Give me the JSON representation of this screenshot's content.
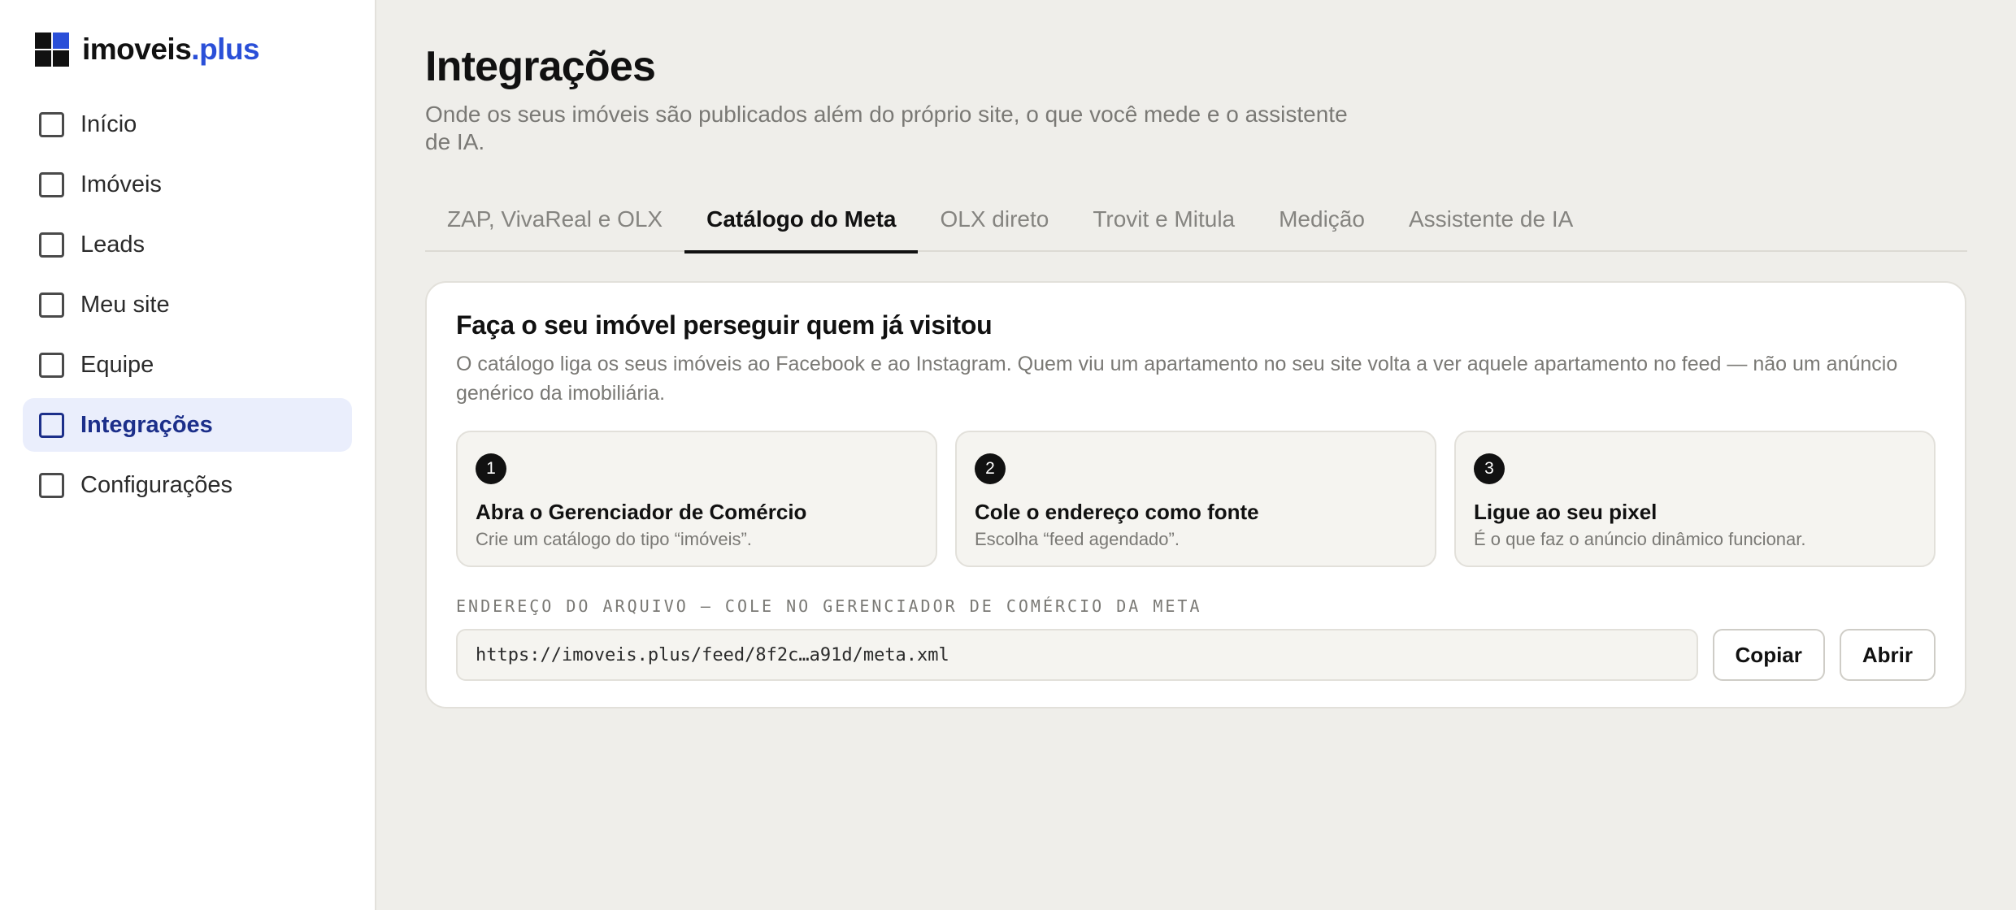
{
  "brand": {
    "name_main": "imoveis",
    "name_accent": ".plus",
    "colors": {
      "blue": "#2a4fd8",
      "dark": "#111111"
    }
  },
  "sidebar": {
    "items": [
      {
        "label": "Início",
        "icon": "checkbox-icon",
        "active": false
      },
      {
        "label": "Imóveis",
        "icon": "checkbox-icon",
        "active": false
      },
      {
        "label": "Leads",
        "icon": "checkbox-icon",
        "active": false
      },
      {
        "label": "Meu site",
        "icon": "checkbox-icon",
        "active": false
      },
      {
        "label": "Equipe",
        "icon": "checkbox-icon",
        "active": false
      },
      {
        "label": "Integrações",
        "icon": "checkbox-icon",
        "active": true
      },
      {
        "label": "Configurações",
        "icon": "checkbox-icon",
        "active": false
      }
    ]
  },
  "header": {
    "title": "Integrações",
    "subtitle": "Onde os seus imóveis são publicados além do próprio site, o que você mede e o assistente de IA."
  },
  "tabs": [
    {
      "label": "ZAP, VivaReal e OLX",
      "active": false
    },
    {
      "label": "Catálogo do Meta",
      "active": true
    },
    {
      "label": "OLX direto",
      "active": false
    },
    {
      "label": "Trovit e Mitula",
      "active": false
    },
    {
      "label": "Medição",
      "active": false
    },
    {
      "label": "Assistente de IA",
      "active": false
    }
  ],
  "card": {
    "title": "Faça o seu imóvel perseguir quem já visitou",
    "description": "O catálogo liga os seus imóveis ao Facebook e ao Instagram. Quem viu um apartamento no seu site volta a ver aquele apartamento no feed — não um anúncio genérico da imobiliária.",
    "steps": [
      {
        "number": "1",
        "title": "Abra o Gerenciador de Comércio",
        "desc": "Crie um catálogo do tipo “imóveis”."
      },
      {
        "number": "2",
        "title": "Cole o endereço como fonte",
        "desc": "Escolha “feed agendado”."
      },
      {
        "number": "3",
        "title": "Ligue ao seu pixel",
        "desc": "É o que faz o anúncio dinâmico funcionar."
      }
    ],
    "field_label": "ENDEREÇO DO ARQUIVO — COLE NO GERENCIADOR DE COMÉRCIO DA META",
    "url_value": "https://imoveis.plus/feed/8f2c…a91d/meta.xml",
    "copy_label": "Copiar",
    "open_label": "Abrir"
  }
}
